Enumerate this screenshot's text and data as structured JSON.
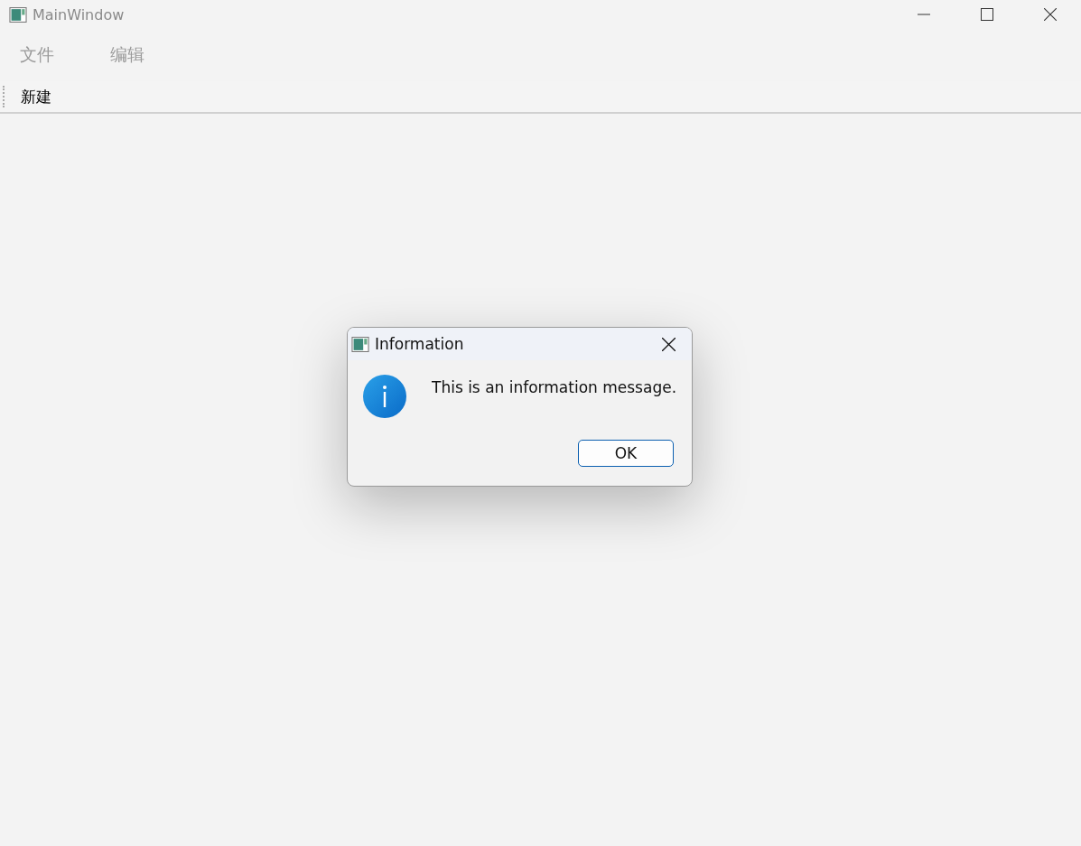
{
  "window": {
    "title": "MainWindow",
    "active": false
  },
  "menu": [
    {
      "label": "文件"
    },
    {
      "label": "编辑"
    }
  ],
  "toolbar": [
    {
      "label": "新建"
    }
  ],
  "dialog": {
    "title": "Information",
    "message": "This is an information message.",
    "buttons": [
      "OK"
    ]
  }
}
